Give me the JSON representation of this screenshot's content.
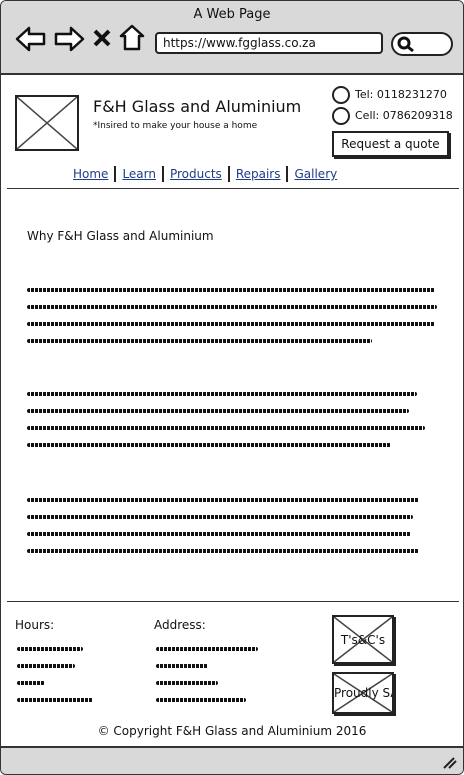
{
  "window": {
    "title": "A Web Page"
  },
  "address_bar": {
    "url": "https://www.fgglass.co.za"
  },
  "header": {
    "company": "F&H Glass and Aluminium",
    "tagline": "*Insired to make your house a home",
    "tel": "Tel: 0118231270",
    "cell": "Cell: 0786209318",
    "quote_button": "Request a quote"
  },
  "nav": {
    "items": [
      {
        "label": "Home"
      },
      {
        "label": "Learn"
      },
      {
        "label": "Products"
      },
      {
        "label": "Repairs"
      },
      {
        "label": "Gallery"
      }
    ]
  },
  "content": {
    "heading": "Why F&H Glass and Aluminium"
  },
  "footer": {
    "hours_label": "Hours:",
    "address_label": "Address:",
    "tcs_label": "T's&C's",
    "proudly_label": "Proudly SA",
    "copyright": "© Copyright F&H Glass and Aluminium 2016"
  }
}
